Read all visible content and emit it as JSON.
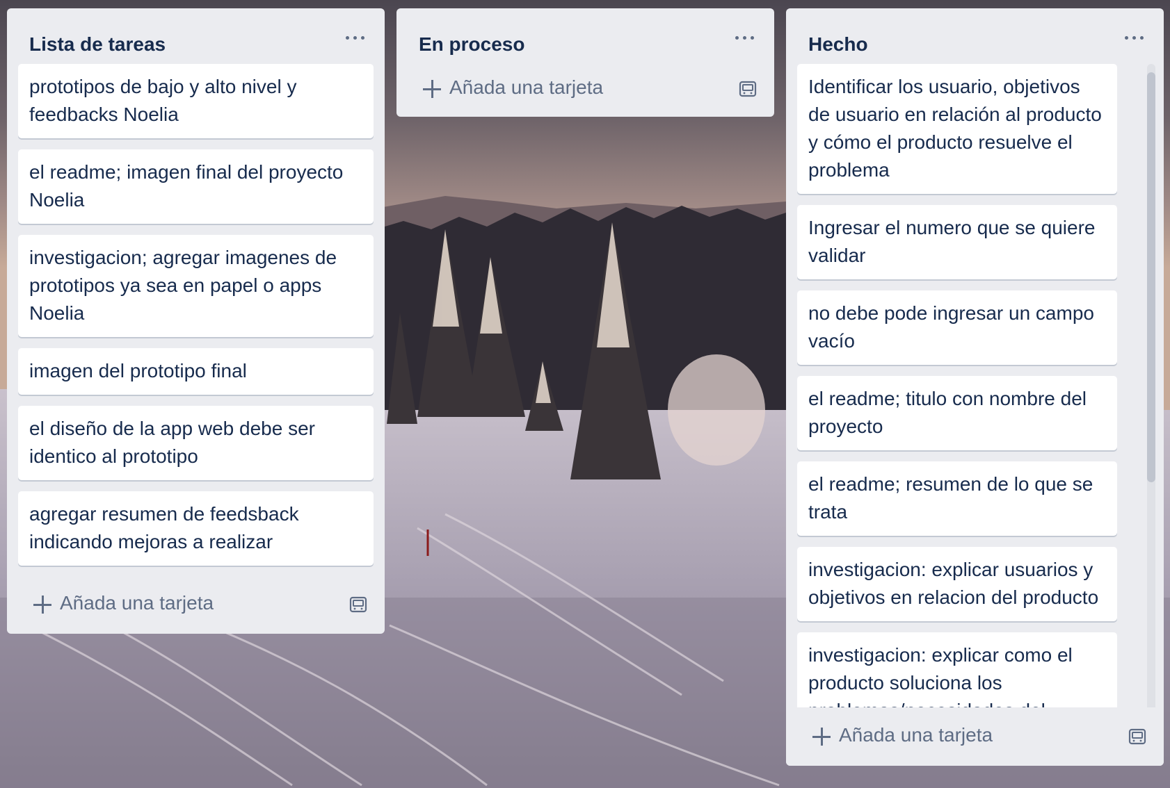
{
  "lists": {
    "todo": {
      "title": "Lista de tareas",
      "cards": [
        "prototipos de bajo y alto nivel y feedbacks Noelia",
        "el readme; imagen final del proyecto Noelia",
        "investigacion; agregar imagenes de prototipos ya sea en papel o apps Noelia",
        "imagen del prototipo final",
        "el diseño de la app web debe ser identico al prototipo",
        "agregar resumen de feedsback indicando mejoras a realizar"
      ],
      "add_card": "Añada una tarjeta"
    },
    "in_progress": {
      "title": "En proceso",
      "cards": [],
      "add_card": "Añada una tarjeta"
    },
    "done": {
      "title": "Hecho",
      "cards": [
        "Identificar los usuario, objetivos de usuario en relación al producto y cómo el producto resuelve el problema",
        "Ingresar el numero que se quiere validar",
        "no debe pode ingresar un campo vacío",
        "el readme; titulo con nombre del proyecto",
        "el readme; resumen de lo que se trata",
        "investigacion: explicar usuarios y objetivos en relacion del producto",
        "investigacion: explicar como el producto soluciona los problemas/necesidades del usuario"
      ],
      "add_card": "Añada una tarjeta"
    }
  },
  "icons": {
    "list_menu": "more-horizontal-icon",
    "add": "plus-icon",
    "template": "card-template-icon"
  },
  "colors": {
    "list_bg": "#ebecf0",
    "card_bg": "#ffffff",
    "text": "#172b4d",
    "muted": "#5e6c84"
  }
}
